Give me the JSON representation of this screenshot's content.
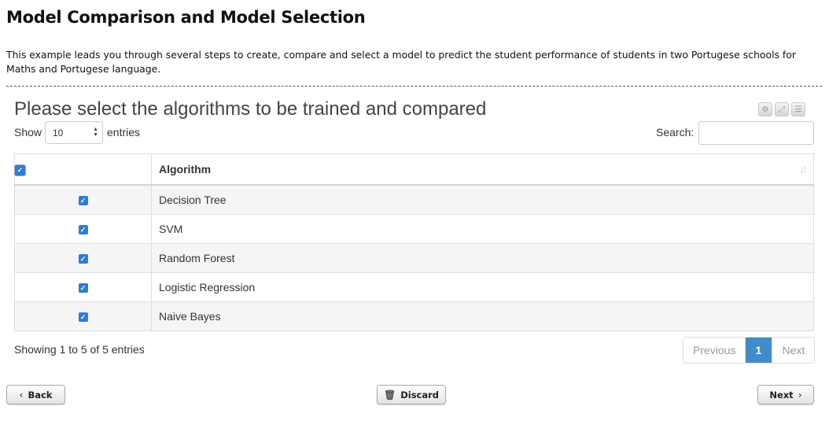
{
  "page": {
    "title": "Model Comparison and Model Selection",
    "intro": "This example leads you through several steps to create, compare and select a model to predict the student performance of students in two Portugese schools for Maths and Portugese language."
  },
  "panel": {
    "title": "Please select the algorithms to be trained and compared",
    "icons": [
      "settings-icon",
      "expand-icon",
      "list-icon"
    ]
  },
  "length_menu": {
    "prefix": "Show",
    "value": "10",
    "suffix": "entries"
  },
  "search": {
    "label": "Search:",
    "value": ""
  },
  "table": {
    "headers": {
      "select_all_checked": true,
      "algorithm": "Algorithm"
    },
    "rows": [
      {
        "checked": true,
        "algorithm": "Decision Tree"
      },
      {
        "checked": true,
        "algorithm": "SVM"
      },
      {
        "checked": true,
        "algorithm": "Random Forest"
      },
      {
        "checked": true,
        "algorithm": "Logistic Regression"
      },
      {
        "checked": true,
        "algorithm": "Naive Bayes"
      }
    ]
  },
  "footer": {
    "info": "Showing 1 to 5 of 5 entries",
    "pagination": {
      "previous": "Previous",
      "current": "1",
      "next": "Next"
    }
  },
  "buttons": {
    "back": "Back",
    "discard": "Discard",
    "next": "Next"
  },
  "colors": {
    "checkbox": "#2e7cd6",
    "active_page": "#428bca"
  }
}
